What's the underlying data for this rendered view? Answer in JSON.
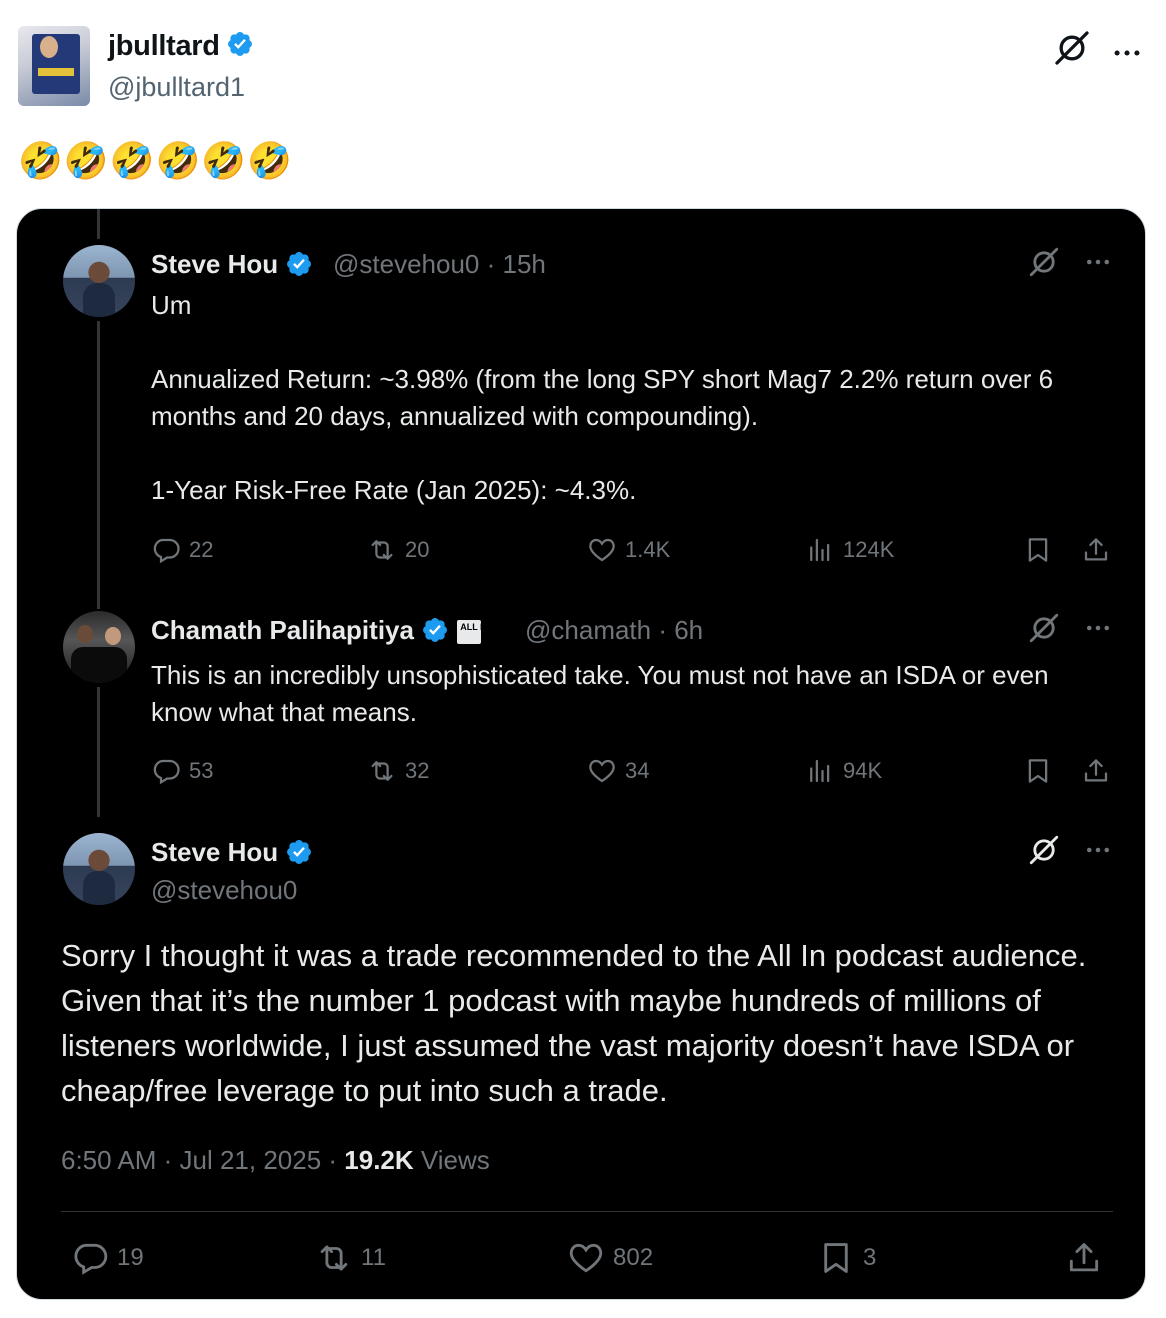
{
  "outer": {
    "name": "jbulltard",
    "handle": "@jbulltard1",
    "text": "🤣🤣🤣🤣🤣🤣"
  },
  "tweet1": {
    "name": "Steve Hou",
    "handle_time": "@stevehou0 · 15h",
    "line1": "Um",
    "line2": "Annualized Return: ~3.98% (from the long SPY short Mag7 2.2% return over 6 months and 20 days, annualized with compounding).",
    "line3": "1-Year Risk-Free Rate (Jan 2025): ~4.3%.",
    "replies": "22",
    "reposts": "20",
    "likes": "1.4K",
    "views": "124K"
  },
  "tweet2": {
    "name": "Chamath Palihapitiya",
    "badge": "ALL IN",
    "handle_time": "@chamath · 6h",
    "text": "This is an incredibly unsophisticated take. You must not have an ISDA or even know what that means.",
    "replies": "53",
    "reposts": "32",
    "likes": "34",
    "views": "94K"
  },
  "tweet3": {
    "name": "Steve Hou",
    "handle": "@stevehou0",
    "text": "Sorry I thought it was a trade recommended to the All In podcast audience. Given that it’s the number 1 podcast with maybe hundreds of millions of listeners worldwide, I just assumed the vast majority doesn’t have ISDA or cheap/free leverage to put into such a trade.",
    "time": "6:50 AM · Jul 21, 2025 · ",
    "views_count": "19.2K",
    "views_label": " Views",
    "replies": "19",
    "reposts": "11",
    "likes": "802",
    "bookmarks": "3"
  },
  "colors": {
    "verified": "#1d9bf0",
    "dark_bg": "#000000",
    "muted": "#71767b"
  }
}
